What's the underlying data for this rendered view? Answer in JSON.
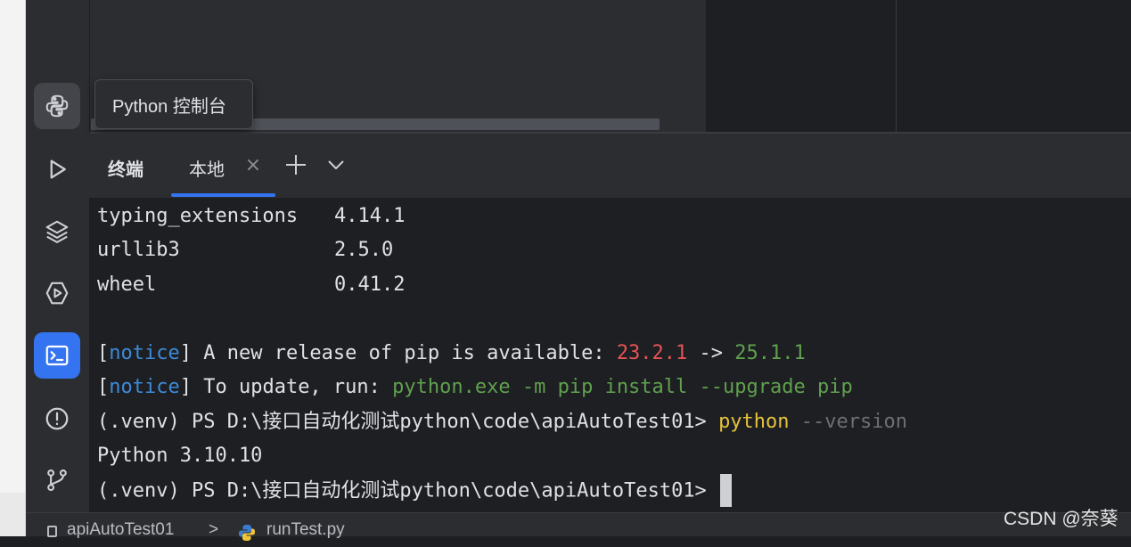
{
  "tooltip": {
    "text": "Python 控制台"
  },
  "toolstrip": {
    "items": [
      {
        "icon": "python-console-icon",
        "state": "hover"
      },
      {
        "icon": "run-icon",
        "state": "normal"
      },
      {
        "icon": "layers-icon",
        "state": "normal"
      },
      {
        "icon": "services-icon",
        "state": "normal"
      },
      {
        "icon": "terminal-icon",
        "state": "active"
      },
      {
        "icon": "problems-icon",
        "state": "normal"
      },
      {
        "icon": "git-icon",
        "state": "normal"
      }
    ]
  },
  "terminal_panel": {
    "title": "终端",
    "tabs": [
      {
        "label": "本地",
        "active": true
      }
    ],
    "accent_color": "#3574f0"
  },
  "terminal": {
    "packages": [
      {
        "name": "typing_extensions",
        "version": "4.14.1"
      },
      {
        "name": "urllib3",
        "version": "2.5.0"
      },
      {
        "name": "wheel",
        "version": "0.41.2"
      }
    ],
    "notice1": {
      "open": "[",
      "tag": "notice",
      "close": "]",
      "text": " A new release of pip is available: ",
      "old_version": "23.2.1",
      "arrow": " -> ",
      "new_version": "25.1.1"
    },
    "notice2": {
      "open": "[",
      "tag": "notice",
      "close": "]",
      "text": " To update, run: ",
      "command": "python.exe -m pip install --upgrade pip"
    },
    "prompt": "(.venv) PS D:\\接口自动化测试python\\code\\apiAutoTest01> ",
    "command_name": "python",
    "command_arg": " --version",
    "output": "Python 3.10.10",
    "prompt2": "(.venv) PS D:\\接口自动化测试python\\code\\apiAutoTest01> "
  },
  "statusbar": {
    "project": "apiAutoTest01",
    "separator": ">",
    "file": "runTest.py"
  },
  "watermark": "CSDN @奈葵"
}
